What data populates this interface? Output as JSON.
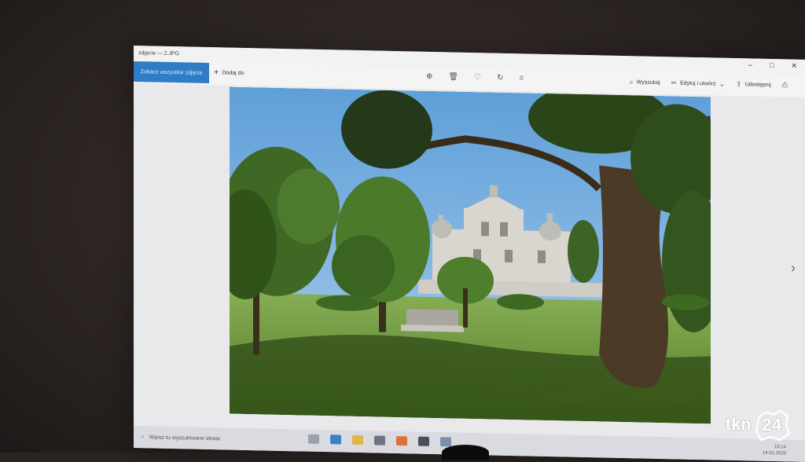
{
  "window": {
    "title": "zdjęcia — 2.JPG",
    "controls": [
      "–",
      "□",
      "✕"
    ]
  },
  "toolbar": {
    "see_all_label": "Zobacz wszystkie zdjęcia",
    "add_to_label": "Dodaj do",
    "center_icons": [
      "zoom-icon",
      "delete-icon",
      "heart-icon",
      "rotate-icon",
      "crop-icon"
    ],
    "search_label": "Wyszukaj",
    "edit_label": "Edytuj i utwórz",
    "share_label": "Udostępnij"
  },
  "taskbar": {
    "search_placeholder": "Wpisz tu wyszukiwane słowa",
    "time": "15:14",
    "date": "14.01.2020"
  },
  "watermark": {
    "brand": "tkn",
    "number": "24"
  },
  "colors": {
    "accent": "#2f7dc6",
    "sky": "#7fb4e4",
    "grass": "#6e9a3a"
  }
}
